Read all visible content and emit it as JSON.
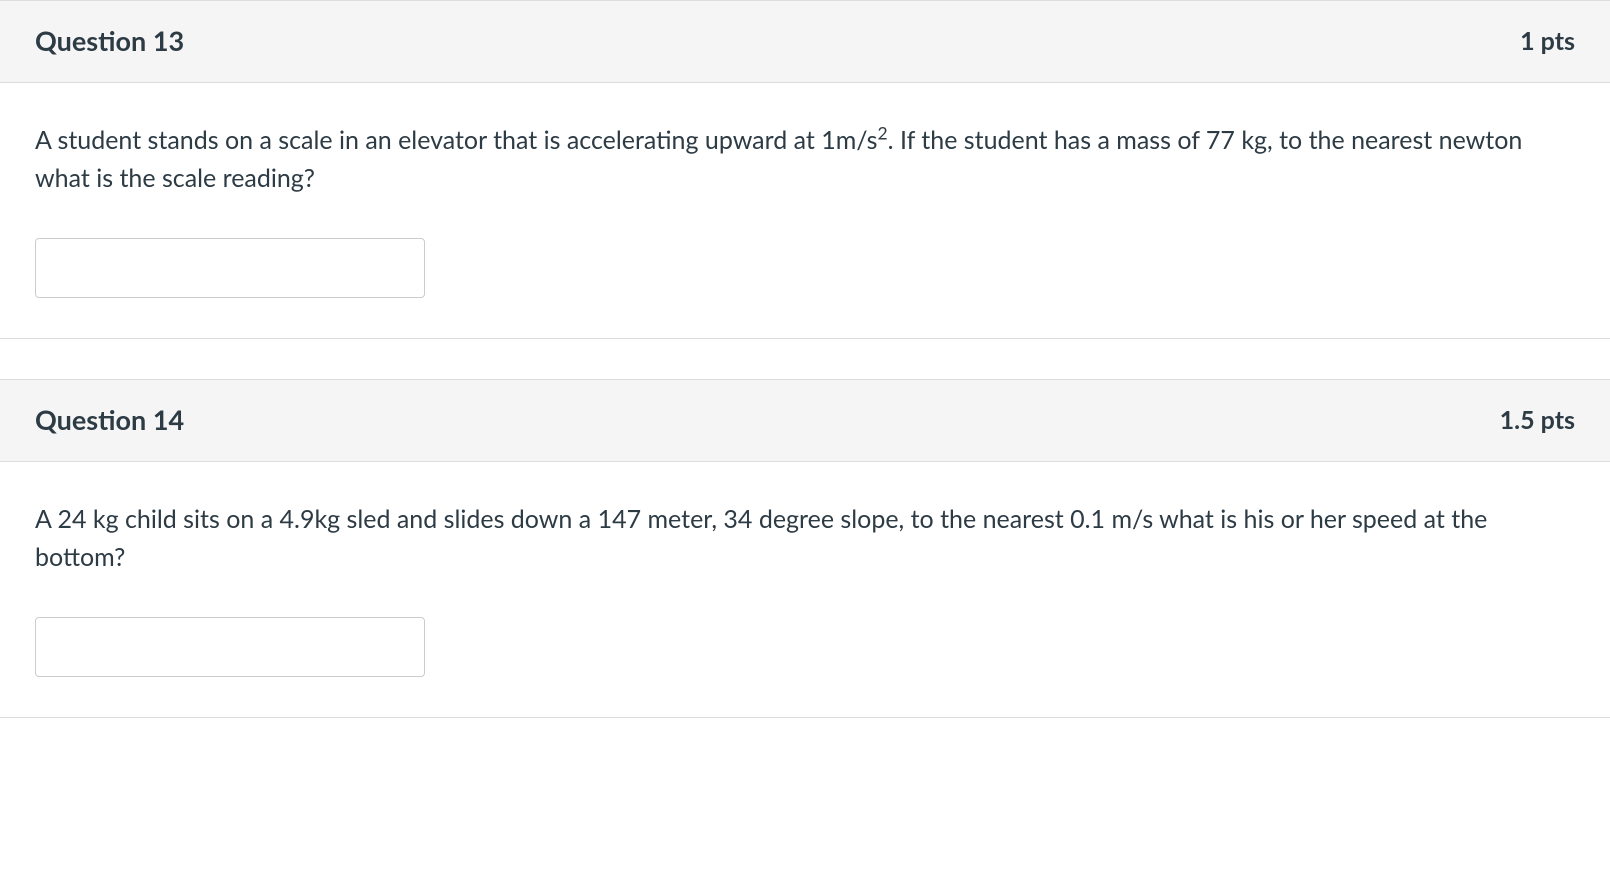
{
  "questions": [
    {
      "title": "Question 13",
      "points": "1 pts",
      "text_pre": "A student stands on a scale in an elevator that is accelerating upward at 1m/s",
      "superscript": "2",
      "text_post": ". If the student has a mass of 77 kg, to the nearest newton what is the scale reading?",
      "answer": ""
    },
    {
      "title": "Question 14",
      "points": "1.5 pts",
      "text_pre": "A 24 kg child sits on a 4.9kg sled and slides down a 147 meter, 34 degree slope, to the nearest 0.1 m/s what is his or her speed at the bottom?",
      "superscript": "",
      "text_post": "",
      "answer": ""
    }
  ]
}
